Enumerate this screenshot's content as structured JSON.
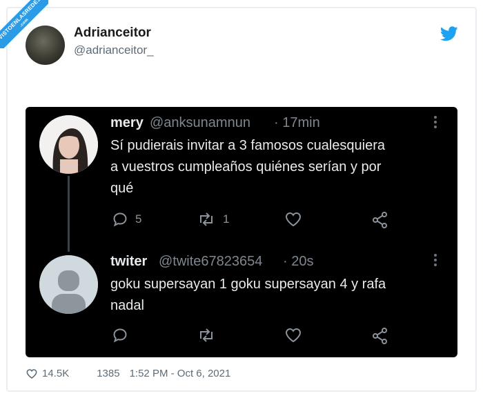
{
  "author": {
    "name": "Adrianceitor",
    "handle": "@adrianceitor_"
  },
  "watermark": {
    "main": "VISTOENLASREDES",
    "sub": ".com"
  },
  "embedded": [
    {
      "name": "mery",
      "handle": "@anksunamnun",
      "time": "· 17min",
      "text_lines": [
        "Sí pudierais invitar a 3 famosos cualesquiera",
        "a vuestros cumpleaños quiénes serían y por",
        "qué"
      ],
      "replies": "5",
      "retweets": "1",
      "likes": ""
    },
    {
      "name": "twiter",
      "handle": "@twite67823654",
      "time": "· 20s",
      "text_lines": [
        "goku supersayan 1 goku supersayan 4 y rafa",
        "nadal"
      ],
      "replies": "",
      "retweets": "",
      "likes": ""
    }
  ],
  "footer": {
    "likes": "14.5K",
    "retweets": "1385",
    "timestamp": "1:52 PM - Oct 6, 2021"
  },
  "colors": {
    "twitter_blue": "#1da1f2",
    "dark_bg": "#000000",
    "muted": "#7e8790"
  }
}
